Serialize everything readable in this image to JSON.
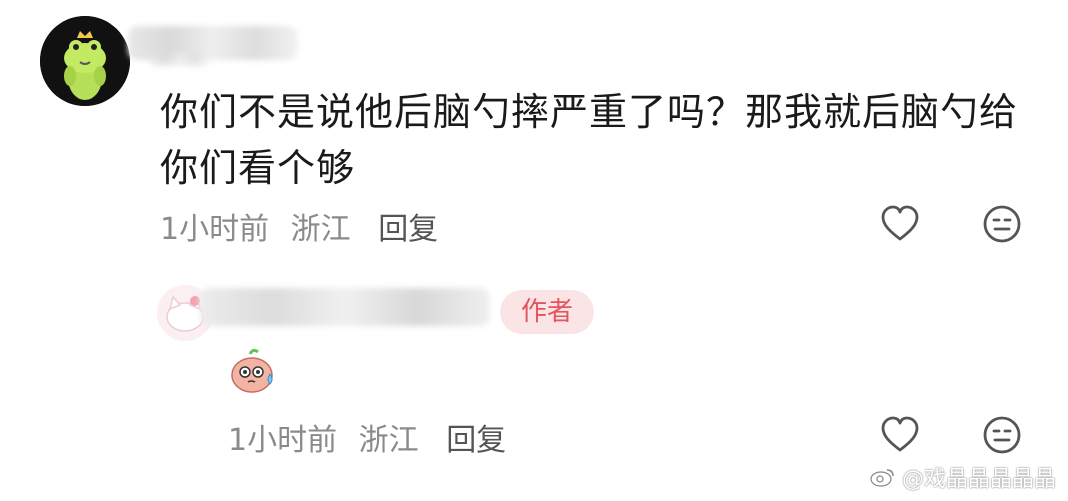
{
  "comment": {
    "text": "你们不是说他后脑勺摔严重了吗？那我就后脑勺给你们看个够",
    "time": "1小时前",
    "location": "浙江",
    "reply_label": "回复"
  },
  "reply": {
    "badge": "作者",
    "time": "1小时前",
    "location": "浙江",
    "reply_label": "回复"
  },
  "watermark": {
    "text": "@戏晶晶晶晶晶"
  },
  "colors": {
    "accent": "#e5555e",
    "meta": "#8a8a8a",
    "icon": "#555555"
  }
}
